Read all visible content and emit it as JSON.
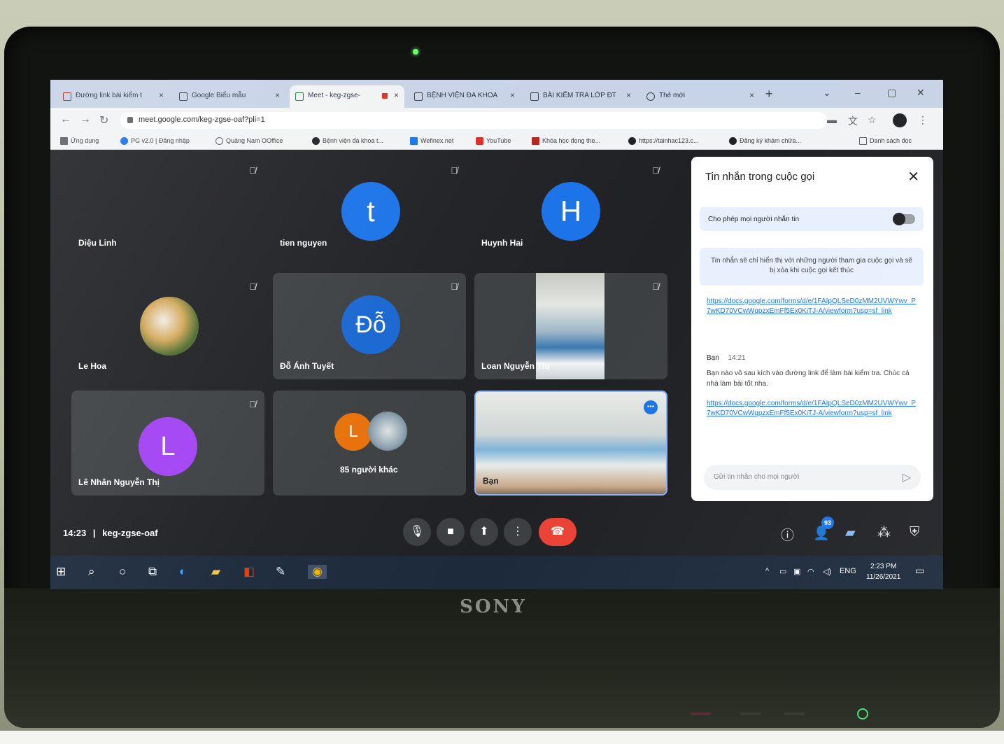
{
  "browser": {
    "tabs": [
      {
        "label": "Đường link bài kiểm t",
        "active": false
      },
      {
        "label": "Google Biểu mẫu",
        "active": false
      },
      {
        "label": "Meet - keg-zgse-",
        "active": true
      },
      {
        "label": "BỆNH VIỆN ĐA KHOA",
        "active": false
      },
      {
        "label": "BÀI KIỂM TRA LỚP ĐT",
        "active": false
      },
      {
        "label": "Thẻ mới",
        "active": false
      }
    ],
    "url": "meet.google.com/keg-zgse-oaf?pli=1",
    "bookmarks": [
      {
        "label": "Ứng dụng",
        "color": "#5f6368"
      },
      {
        "label": "PG v2.0 | Đăng nhập",
        "color": "#1a73e8"
      },
      {
        "label": "Quảng Nam OOffice",
        "color": "#5f6368"
      },
      {
        "label": "Bệnh viện đa khoa t...",
        "color": "#202124"
      },
      {
        "label": "Wefinex.net",
        "color": "#1a73e8"
      },
      {
        "label": "YouTube",
        "color": "#d93025"
      },
      {
        "label": "Khóa học đọng the...",
        "color": "#b3261e"
      },
      {
        "label": "https://tainhac123.c...",
        "color": "#202124"
      },
      {
        "label": "Đăng ký khám chữa...",
        "color": "#202124"
      },
      {
        "label": "Danh sách đọc",
        "color": "#5f6368"
      }
    ]
  },
  "meet": {
    "participants": [
      {
        "name": "Diệu Linh"
      },
      {
        "name": "tien nguyen",
        "initial": "t",
        "color": "#1a73e8"
      },
      {
        "name": "Huynh Hai",
        "initial": "H",
        "color": "#1a73e8"
      },
      {
        "name": "Le Hoa"
      },
      {
        "name": "Đỗ Ánh Tuyết",
        "initial": "Đỗ",
        "color": "#1967d2"
      },
      {
        "name": "Loan Nguyễn Thị"
      },
      {
        "name": "Lê Nhân Nguyễn Thị",
        "initial": "L",
        "color": "#a142f4"
      },
      {
        "name": "85 người khác",
        "initial": "L",
        "color": "#e8710a"
      },
      {
        "name": "Bạn"
      }
    ],
    "meeting_time": "14:23",
    "meeting_code": "keg-zgse-oaf",
    "participant_count": "93",
    "chat": {
      "title": "Tin nhắn trong cuộc gọi",
      "toggle_label": "Cho phép mọi người nhắn tin",
      "note": "Tin nhắn sẽ chỉ hiển thị với những người tham gia cuộc gọi và sẽ bị xóa khi cuộc gọi kết thúc",
      "link1": "https://docs.google.com/forms/d/e/1FAIpQLSeD0zMM2UVWYwv_P7wKD70VCwWqpzxEmFf5Ex0KiTJ-A/viewform?usp=sf_link",
      "message_author": "Bạn",
      "message_time": "14:21",
      "message_text": "Bạn nào vô sau kích vào đường link để làm bài kiểm tra. Chúc cả nhà làm bài tốt nha.",
      "link2": "https://docs.google.com/forms/d/e/1FAIpQLSeD0zMM2UVWYwv_P7wKD70VCwWqpzxEmFf5Ex0KiTJ-A/viewform?usp=sf_link",
      "input_placeholder": "Gửi tin nhắn cho mọi người"
    }
  },
  "taskbar": {
    "language": "ENG",
    "time": "2:23 PM",
    "date": "11/26/2021"
  },
  "laptop": {
    "brand": "SONY"
  }
}
